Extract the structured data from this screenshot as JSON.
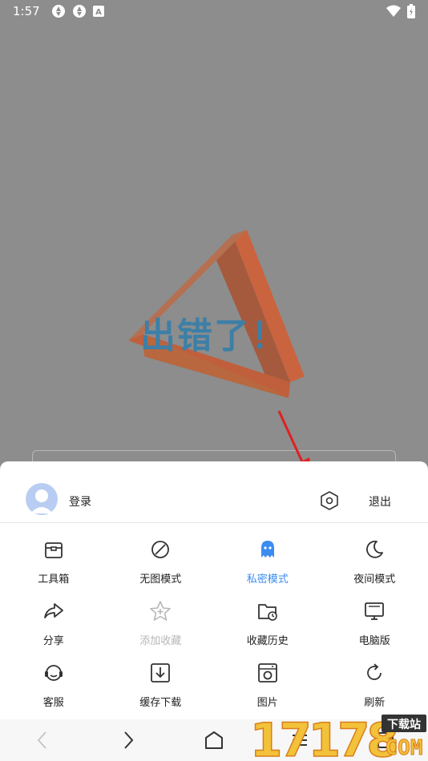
{
  "status_bar": {
    "time": "1:57",
    "left_icons": [
      "app-icon",
      "app-icon",
      "a-icon"
    ],
    "right_icons": [
      "wifi-icon",
      "battery-icon"
    ]
  },
  "page": {
    "error_text": "出错了！"
  },
  "menu": {
    "login_label": "登录",
    "exit_label": "退出",
    "items": [
      {
        "label": "工具箱",
        "icon": "toolbox-icon"
      },
      {
        "label": "无图模式",
        "icon": "no-image-icon"
      },
      {
        "label": "私密模式",
        "icon": "ghost-icon"
      },
      {
        "label": "夜间模式",
        "icon": "moon-icon"
      },
      {
        "label": "分享",
        "icon": "share-icon"
      },
      {
        "label": "添加收藏",
        "icon": "star-add-icon"
      },
      {
        "label": "收藏历史",
        "icon": "folder-history-icon"
      },
      {
        "label": "电脑版",
        "icon": "desktop-icon"
      },
      {
        "label": "客服",
        "icon": "headset-icon"
      },
      {
        "label": "缓存下载",
        "icon": "download-icon"
      },
      {
        "label": "图片",
        "icon": "image-icon"
      },
      {
        "label": "刷新",
        "icon": "refresh-icon"
      }
    ],
    "active_color": "#3b8cf0",
    "disabled_color": "#b7b7b7"
  },
  "bottom_nav": [
    "back-icon",
    "forward-icon",
    "home-icon",
    "menu-icon",
    "tabs-icon"
  ],
  "watermark": {
    "number": "17178",
    "tag": "下载站",
    "domain": "COM"
  }
}
